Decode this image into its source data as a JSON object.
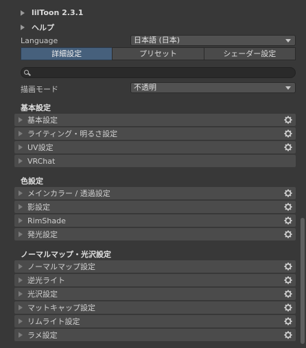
{
  "header": {
    "version": "lilToon 2.3.1",
    "help": "ヘルプ"
  },
  "language": {
    "label": "Language",
    "value": "日本語 (日本)"
  },
  "tabs": [
    "詳細設定",
    "プリセット",
    "シェーダー設定"
  ],
  "render_mode": {
    "label": "描画モード",
    "value": "不透明"
  },
  "sections": {
    "basic": {
      "title": "基本設定",
      "items": [
        "基本設定",
        "ライティング・明るさ設定",
        "UV設定",
        "VRChat"
      ]
    },
    "color": {
      "title": "色設定",
      "items": [
        "メインカラー / 透過設定",
        "影設定",
        "RimShade",
        "発光設定"
      ]
    },
    "normal": {
      "title": "ノーマルマップ・光沢設定",
      "items": [
        "ノーマルマップ設定",
        "逆光ライト",
        "光沢設定",
        "マットキャップ設定",
        "リムライト設定",
        "ラメ設定"
      ]
    }
  },
  "colors": {
    "background": "#383838",
    "row": "#4b4b4b",
    "active_tab": "#46607c"
  }
}
